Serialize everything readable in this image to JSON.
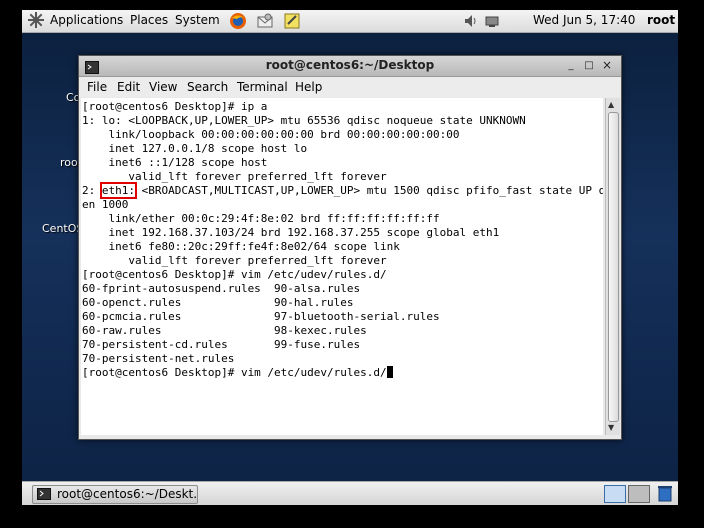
{
  "top_panel": {
    "menus": [
      "Applications",
      "Places",
      "System"
    ],
    "datetime": "Wed Jun  5, 17:40",
    "user": "root"
  },
  "desktop_icons": [
    {
      "label": "Co"
    },
    {
      "label": "roo"
    },
    {
      "label": "CentOS"
    }
  ],
  "window": {
    "title": "root@centos6:~/Desktop",
    "controls": [
      "_",
      "□",
      "×"
    ],
    "menu": [
      "File",
      "Edit",
      "View",
      "Search",
      "Terminal",
      "Help"
    ]
  },
  "terminal": {
    "lines": [
      "[root@centos6 Desktop]# ip a",
      "1: lo: <LOOPBACK,UP,LOWER_UP> mtu 65536 qdisc noqueue state UNKNOWN",
      "    link/loopback 00:00:00:00:00:00 brd 00:00:00:00:00:00",
      "    inet 127.0.0.1/8 scope host lo",
      "    inet6 ::1/128 scope host",
      "       valid_lft forever preferred_lft forever",
      "",
      "en 1000",
      "    link/ether 00:0c:29:4f:8e:02 brd ff:ff:ff:ff:ff:ff",
      "    inet 192.168.37.103/24 brd 192.168.37.255 scope global eth1",
      "    inet6 fe80::20c:29ff:fe4f:8e02/64 scope link",
      "       valid_lft forever preferred_lft forever",
      "[root@centos6 Desktop]# vim /etc/udev/rules.d/",
      "60-fprint-autosuspend.rules  90-alsa.rules",
      "60-openct.rules              90-hal.rules",
      "60-pcmcia.rules              97-bluetooth-serial.rules",
      "60-raw.rules                 98-kexec.rules",
      "70-persistent-cd.rules       99-fuse.rules",
      "70-persistent-net.rules",
      "[root@centos6 Desktop]# vim /etc/udev/rules.d/"
    ],
    "eth1_line": {
      "prefix": "2: ",
      "highlight": "eth1:",
      "rest": " <BROADCAST,MULTICAST,UP,LOWER_UP> mtu 1500 qdisc pfifo_fast state UP ql"
    }
  },
  "taskbar": {
    "task_label": "root@centos6:~/Deskt..."
  },
  "colors": {
    "highlight_box": "#e00000",
    "desktop_bg": "#15305a"
  }
}
